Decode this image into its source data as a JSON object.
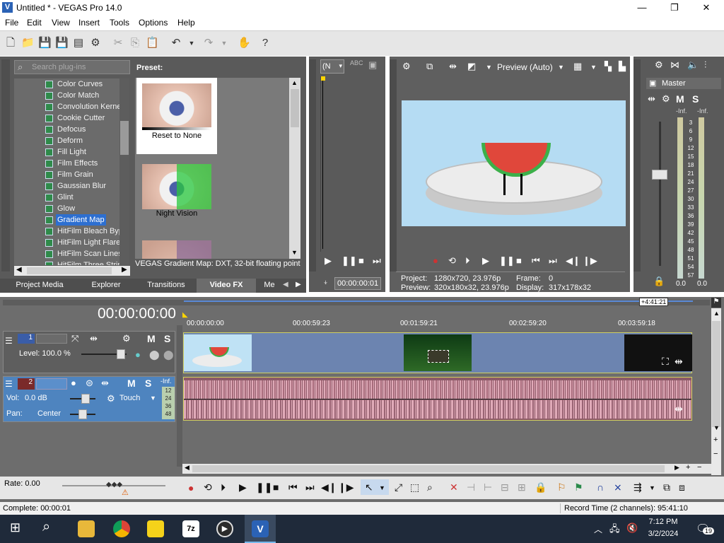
{
  "window": {
    "title": "Untitled * - VEGAS Pro 14.0",
    "minimize": "—",
    "maximize": "❐",
    "close": "✕"
  },
  "menu": [
    "File",
    "Edit",
    "View",
    "Insert",
    "Tools",
    "Options",
    "Help"
  ],
  "fx_panel": {
    "search_placeholder": "Search plug-ins",
    "tree_items": [
      "Color Curves",
      "Color Match",
      "Convolution Kerne",
      "Cookie Cutter",
      "Defocus",
      "Deform",
      "Fill Light",
      "Film Effects",
      "Film Grain",
      "Gaussian Blur",
      "Glint",
      "Glow",
      "Gradient Map",
      "HitFilm Bleach Byp",
      "HitFilm Light Flares",
      "HitFilm Scan Lines",
      "HitFilm Three Strip"
    ],
    "selected_item": "Gradient Map",
    "preset_label": "Preset:",
    "presets": [
      "Reset to None",
      "Night Vision"
    ],
    "description": "VEGAS Gradient Map: DXT, 32-bit floating point",
    "tabs": [
      "Project Media",
      "Explorer",
      "Transitions",
      "Video FX",
      "Me"
    ],
    "active_tab": "Video FX"
  },
  "trimmer": {
    "dropdown": "(N",
    "timecode": "00:00:00:01"
  },
  "preview": {
    "mode": "Preview (Auto)",
    "project_label": "Project:",
    "project_value": "1280x720, 23.976p",
    "preview_label": "Preview:",
    "preview_value": "320x180x32, 23.976p",
    "frame_label": "Frame:",
    "frame_value": "0",
    "display_label": "Display:",
    "display_value": "317x178x32"
  },
  "master": {
    "label": "Master",
    "m": "M",
    "s": "S",
    "left_peak": "-Inf.",
    "right_peak": "-Inf.",
    "left_val": "0.0",
    "right_val": "0.0",
    "scale": [
      "3",
      "6",
      "9",
      "12",
      "15",
      "18",
      "21",
      "24",
      "27",
      "30",
      "33",
      "36",
      "39",
      "42",
      "45",
      "48",
      "51",
      "54",
      "57"
    ]
  },
  "timeline": {
    "timecode": "00:00:00:00",
    "length_badge": "+4:41:21",
    "ruler": [
      "00:00:00:00",
      "00:00:59:23",
      "00:01:59:21",
      "00:02:59:20",
      "00:03:59:18"
    ],
    "track1": {
      "number": "1",
      "m": "M",
      "s": "S",
      "level": "Level: 100.0 %"
    },
    "track2": {
      "number": "2",
      "m": "M",
      "s": "S",
      "vol": "Vol:",
      "vol_value": "0.0 dB",
      "pan": "Pan:",
      "pan_value": "Center",
      "automation": "Touch",
      "peak": "-Inf.",
      "meter": [
        "12",
        "24",
        "36",
        "48"
      ]
    }
  },
  "rate": "Rate: 0.00",
  "status": {
    "left": "Complete: 00:00:01",
    "right": "Record Time (2 channels): 95:41:10"
  },
  "taskbar": {
    "time": "7:12 PM",
    "date": "3/2/2024",
    "notifications": "19"
  }
}
